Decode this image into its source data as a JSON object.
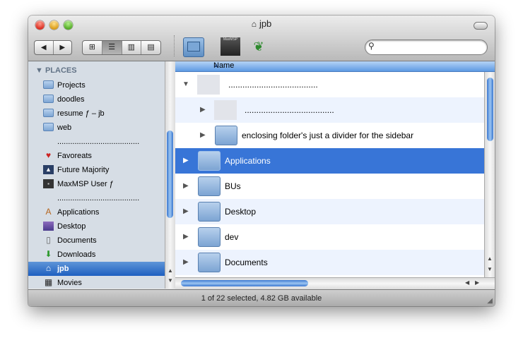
{
  "window": {
    "title": "jpb"
  },
  "toolbar": {
    "back": "◀",
    "forward": "▶",
    "views": [
      "⊞",
      "☰",
      "▥",
      "▤"
    ],
    "maxmsp_icon_text": "MaxMSP",
    "search": {
      "value": "",
      "placeholder": ""
    }
  },
  "sidebar": {
    "heading": "PLACES",
    "items": [
      {
        "label": "Projects",
        "icon": "folder-icon"
      },
      {
        "label": "doodles",
        "icon": "folder-icon"
      },
      {
        "label": "resume ƒ – jb",
        "icon": "folder-icon"
      },
      {
        "label": "web",
        "icon": "folder-icon"
      },
      {
        "label": "......................................",
        "icon": "none"
      },
      {
        "label": "Favoreats",
        "icon": "favoreats-icon"
      },
      {
        "label": "Future Majority",
        "icon": "future-majority-icon"
      },
      {
        "label": "MaxMSP User ƒ",
        "icon": "maxmsp-icon"
      },
      {
        "label": "......................................",
        "icon": "none"
      },
      {
        "label": "Applications",
        "icon": "applications-icon"
      },
      {
        "label": "Desktop",
        "icon": "desktop-icon"
      },
      {
        "label": "Documents",
        "icon": "documents-icon"
      },
      {
        "label": "Downloads",
        "icon": "downloads-icon"
      },
      {
        "label": "jpb",
        "icon": "home-icon",
        "selected": true
      },
      {
        "label": "Movies",
        "icon": "movies-icon"
      }
    ]
  },
  "list": {
    "column_header": "Name",
    "rows": [
      {
        "name": "......................................",
        "expanded": true
      },
      {
        "name": "......................................"
      },
      {
        "name": "enclosing folder's just a divider for the sidebar"
      },
      {
        "name": "Applications",
        "selected": true
      },
      {
        "name": "BUs"
      },
      {
        "name": "Desktop"
      },
      {
        "name": "dev"
      },
      {
        "name": "Documents"
      }
    ]
  },
  "status": {
    "text": "1 of 22 selected, 4.82 GB available"
  },
  "colors": {
    "selection": "#3875d7",
    "sidebar_bg": "#d6dde5",
    "row_alt": "#edf3fe"
  }
}
